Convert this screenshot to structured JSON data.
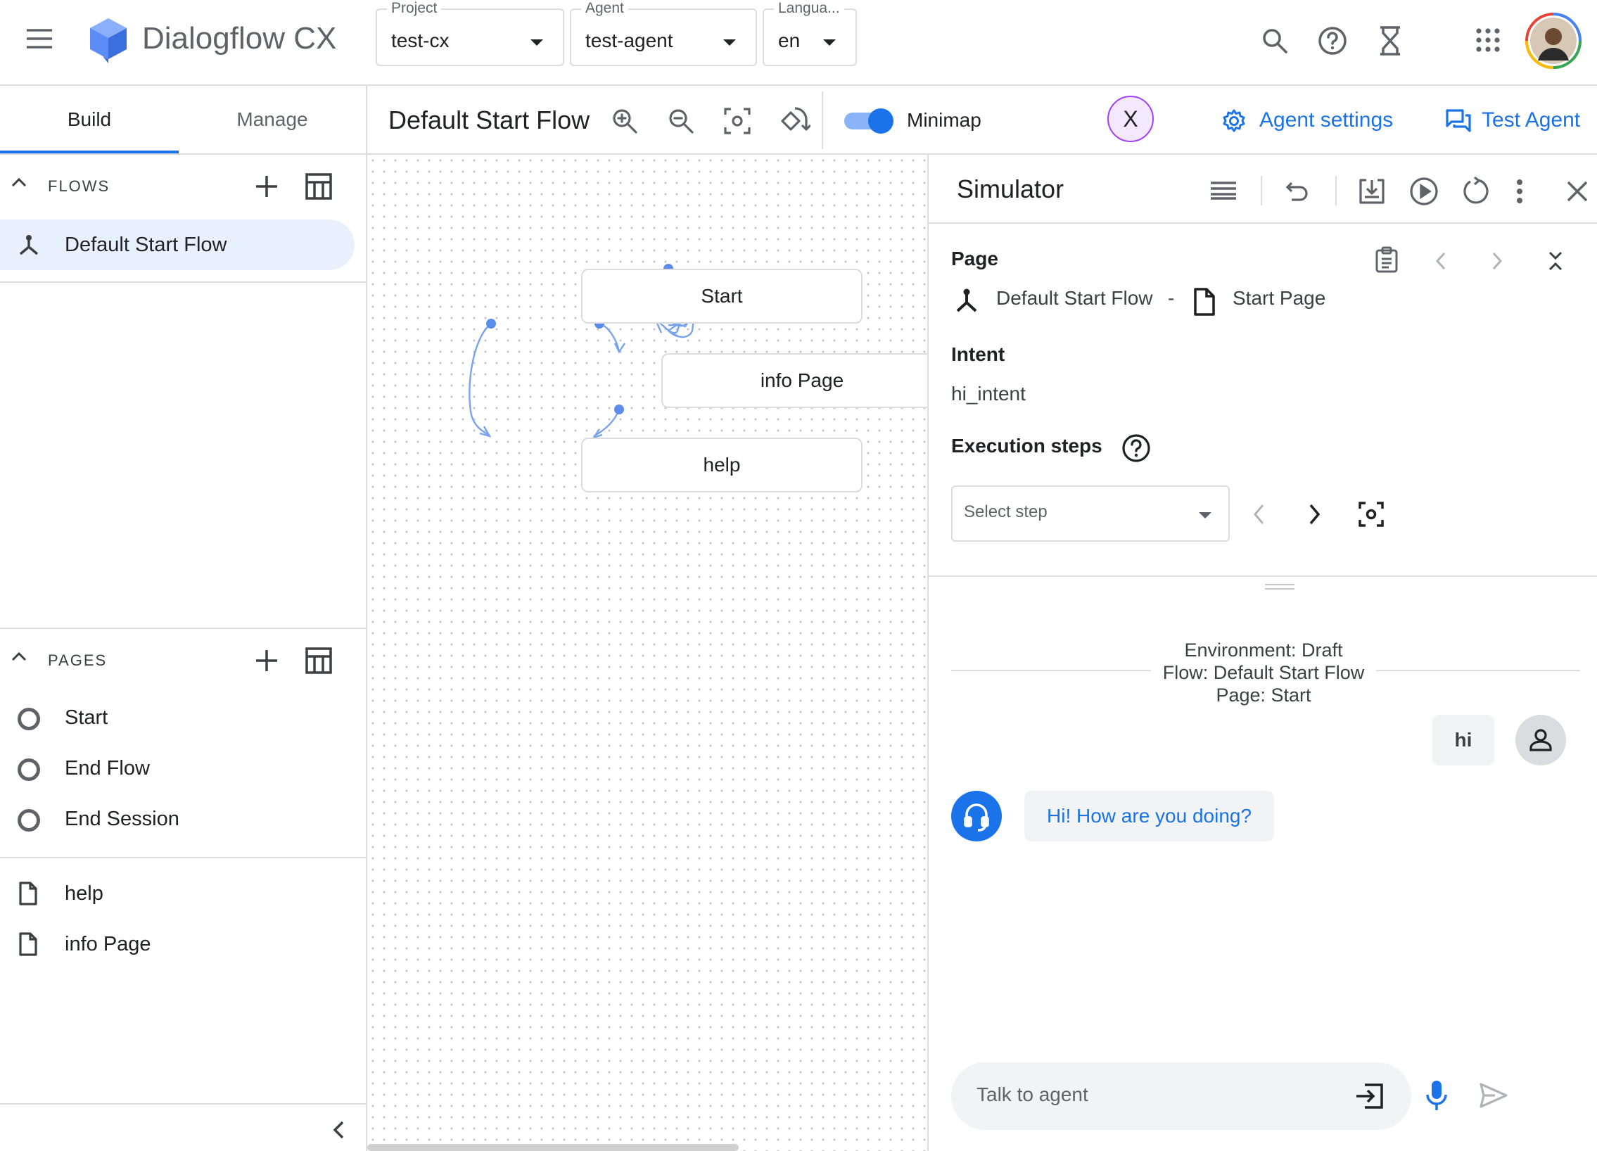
{
  "app": {
    "title": "Dialogflow CX",
    "icons": [
      "menu-icon",
      "dialogflow-logo",
      "search-icon",
      "help-icon",
      "hourglass-icon",
      "apps-grid-icon",
      "avatar"
    ]
  },
  "selectors": {
    "project": {
      "label": "Project",
      "value": "test-cx"
    },
    "agent": {
      "label": "Agent",
      "value": "test-agent"
    },
    "language": {
      "label": "Langua...",
      "value": "en"
    }
  },
  "sidebar": {
    "tabs": [
      {
        "label": "Build",
        "active": true
      },
      {
        "label": "Manage",
        "active": false
      }
    ],
    "flows_header": "FLOWS",
    "flows": [
      {
        "label": "Default Start Flow",
        "selected": true
      }
    ],
    "pages_header": "PAGES",
    "pages_builtin": [
      {
        "label": "Start"
      },
      {
        "label": "End Flow"
      },
      {
        "label": "End Session"
      }
    ],
    "pages": [
      {
        "label": "help"
      },
      {
        "label": "info Page"
      }
    ]
  },
  "toolbar": {
    "flow_title": "Default Start Flow",
    "minimap_label": "Minimap",
    "minimap_on": true,
    "close_badge": "X",
    "agent_settings": "Agent settings",
    "test_agent": "Test Agent"
  },
  "graph": {
    "nodes": [
      {
        "label": "Start"
      },
      {
        "label": "info Page"
      },
      {
        "label": "help"
      }
    ]
  },
  "simulator": {
    "title": "Simulator",
    "page_heading": "Page",
    "flow_name": "Default Start Flow",
    "separator": "-",
    "page_name": "Start Page",
    "intent_heading": "Intent",
    "intent_value": "hi_intent",
    "exec_heading": "Execution steps",
    "select_step_placeholder": "Select step",
    "env_lines": [
      "Environment: Draft",
      "Flow: Default Start Flow",
      "Page: Start"
    ],
    "messages": [
      {
        "from": "user",
        "text": "hi"
      },
      {
        "from": "agent",
        "text": "Hi! How are you doing?"
      }
    ],
    "input_placeholder": "Talk to agent"
  },
  "colors": {
    "accent": "#1a73e8",
    "selected_bg": "#e8f0fe",
    "border": "#dadce0",
    "badge_border": "#a142f4"
  }
}
